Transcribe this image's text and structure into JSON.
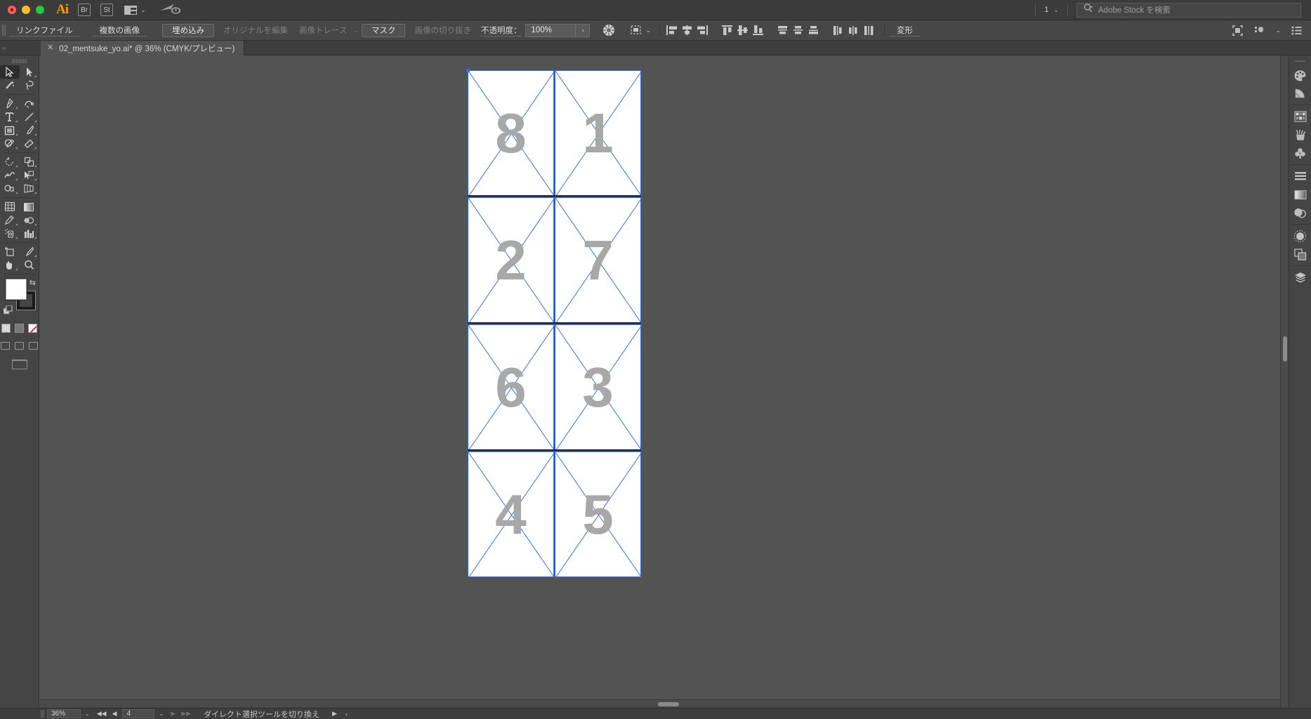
{
  "titlebar": {
    "app_name": "Ai",
    "bridge_label": "Br",
    "stock_label": "St",
    "doc_count": "1",
    "search_placeholder": "Adobe Stock を検索",
    "icons": {
      "arrange": "arrange-documents-icon",
      "cloud": "cloud-sync-icon",
      "search": "search-icon",
      "chevron": "chevron-down-icon"
    }
  },
  "controlbar": {
    "link_file_label": "リンクファイル",
    "multiple_images_label": "複数の画像",
    "embed_button": "埋め込み",
    "edit_original_button": "オリジナルを編集",
    "image_trace_button": "画像トレース",
    "mask_button": "マスク",
    "crop_image_button": "画像の切り抜き",
    "opacity_label": "不透明度：",
    "opacity_value": "100%",
    "transform_label": "変形",
    "align_icons": [
      "align-left-icon",
      "align-horizontal-center-icon",
      "align-right-icon",
      "align-top-icon",
      "align-vertical-center-icon",
      "align-bottom-icon",
      "distribute-top-icon",
      "distribute-vertical-center-icon",
      "distribute-bottom-icon",
      "distribute-left-icon",
      "distribute-horizontal-center-icon",
      "distribute-right-icon"
    ],
    "right_icons": [
      "align-to-selection-icon",
      "arrange-object-icon",
      "document-setup-icon"
    ]
  },
  "tabbar": {
    "document_title": "02_mentsuke_yo.ai* @ 36% (CMYK/プレビュー)",
    "close_glyph": "✕"
  },
  "toolbar": {
    "tools": [
      {
        "name": "selection-tool",
        "selected": true
      },
      {
        "name": "direct-selection-tool",
        "selected": false
      },
      {
        "name": "magic-wand-tool",
        "selected": false
      },
      {
        "name": "lasso-tool",
        "selected": false
      },
      {
        "name": "pen-tool",
        "selected": false
      },
      {
        "name": "curvature-tool",
        "selected": false
      },
      {
        "name": "type-tool",
        "selected": false
      },
      {
        "name": "line-segment-tool",
        "selected": false
      },
      {
        "name": "rectangle-tool",
        "selected": false
      },
      {
        "name": "paintbrush-tool",
        "selected": false
      },
      {
        "name": "shaper-tool",
        "selected": false
      },
      {
        "name": "eraser-tool",
        "selected": false
      },
      {
        "name": "rotate-tool",
        "selected": false
      },
      {
        "name": "scale-tool",
        "selected": false
      },
      {
        "name": "width-tool",
        "selected": false
      },
      {
        "name": "free-transform-tool",
        "selected": false
      },
      {
        "name": "shape-builder-tool",
        "selected": false
      },
      {
        "name": "perspective-grid-tool",
        "selected": false
      },
      {
        "name": "mesh-tool",
        "selected": false
      },
      {
        "name": "gradient-tool",
        "selected": false
      },
      {
        "name": "eyedropper-tool",
        "selected": false
      },
      {
        "name": "blend-tool",
        "selected": false
      },
      {
        "name": "symbol-sprayer-tool",
        "selected": false
      },
      {
        "name": "column-graph-tool",
        "selected": false
      },
      {
        "name": "artboard-tool",
        "selected": false
      },
      {
        "name": "slice-tool",
        "selected": false
      },
      {
        "name": "hand-tool",
        "selected": false
      },
      {
        "name": "zoom-tool",
        "selected": false
      }
    ],
    "fill_color": "#ffffff",
    "stroke_color": "#1a1a1a",
    "swatch_names": [
      "fill-swatch",
      "stroke-swatch",
      "swap-fill-stroke-icon",
      "default-fill-stroke-icon"
    ],
    "mode_buttons": [
      "color-mode-button",
      "gradient-mode-button",
      "none-mode-button"
    ],
    "screen_buttons": [
      "change-screen-mode-button",
      "presentation-mode-button"
    ]
  },
  "rightpanel": {
    "icons": [
      "color-palette-icon",
      "color-guide-icon",
      "swatches-icon",
      "brushes-icon",
      "symbols-icon",
      "align-panel-icon",
      "gradient-icon",
      "transparency-icon",
      "appearance-icon",
      "artboards-icon",
      "layers-icon"
    ]
  },
  "artwork": {
    "accent_color": "#3a6fd8",
    "number_color": "#a8a8a8",
    "panels": [
      {
        "label": "8",
        "col": 0,
        "row": 0
      },
      {
        "label": "1",
        "col": 1,
        "row": 0
      },
      {
        "label": "2",
        "col": 0,
        "row": 1
      },
      {
        "label": "7",
        "col": 1,
        "row": 1
      },
      {
        "label": "6",
        "col": 0,
        "row": 2
      },
      {
        "label": "3",
        "col": 1,
        "row": 2
      },
      {
        "label": "4",
        "col": 0,
        "row": 3
      },
      {
        "label": "5",
        "col": 1,
        "row": 3
      }
    ]
  },
  "statusbar": {
    "zoom_value": "36%",
    "page_value": "4",
    "message": "ダイレクト選択ツールを切り換え",
    "nav_first": "◀◀",
    "nav_prev": "◀",
    "nav_next": "▶",
    "nav_last": "▶▶",
    "expand_glyph": "▶",
    "collapse_glyph": "‹"
  }
}
